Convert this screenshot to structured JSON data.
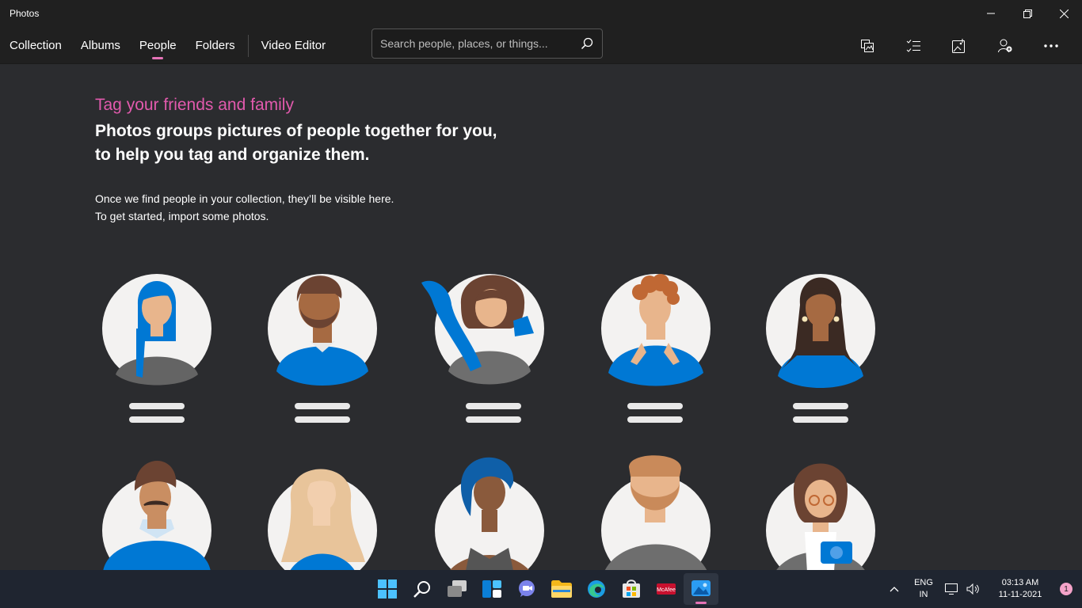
{
  "app": {
    "title": "Photos"
  },
  "nav": {
    "tabs": [
      {
        "label": "Collection"
      },
      {
        "label": "Albums"
      },
      {
        "label": "People",
        "active": true
      },
      {
        "label": "Folders"
      },
      {
        "label": "Video Editor"
      }
    ],
    "search_placeholder": "Search people, places, or things..."
  },
  "toolbar": {
    "icons": [
      "select-photos-icon",
      "multi-select-icon",
      "import-icon",
      "account-icon",
      "more-options-icon"
    ]
  },
  "main": {
    "eyebrow": "Tag your friends and family",
    "headline": "Photos groups pictures of people together for you, to help you tag and organize them.",
    "line1": "Once we find people in your collection, they’ll be visible here.",
    "line2": "To get started, import some photos."
  },
  "colors": {
    "accent_pink": "#e25aad",
    "brand_blue": "#0078d4",
    "background": "#2b2c2f"
  },
  "taskbar": {
    "icons": [
      "windows-start-icon",
      "search-icon",
      "task-view-icon",
      "widgets-icon",
      "teams-chat-icon",
      "file-explorer-icon",
      "edge-icon",
      "store-icon",
      "mcafee-icon",
      "photos-app-icon"
    ],
    "language": "ENG",
    "region": "IN",
    "time": "03:13 AM",
    "date": "11-11-2021",
    "notifications": "1"
  }
}
